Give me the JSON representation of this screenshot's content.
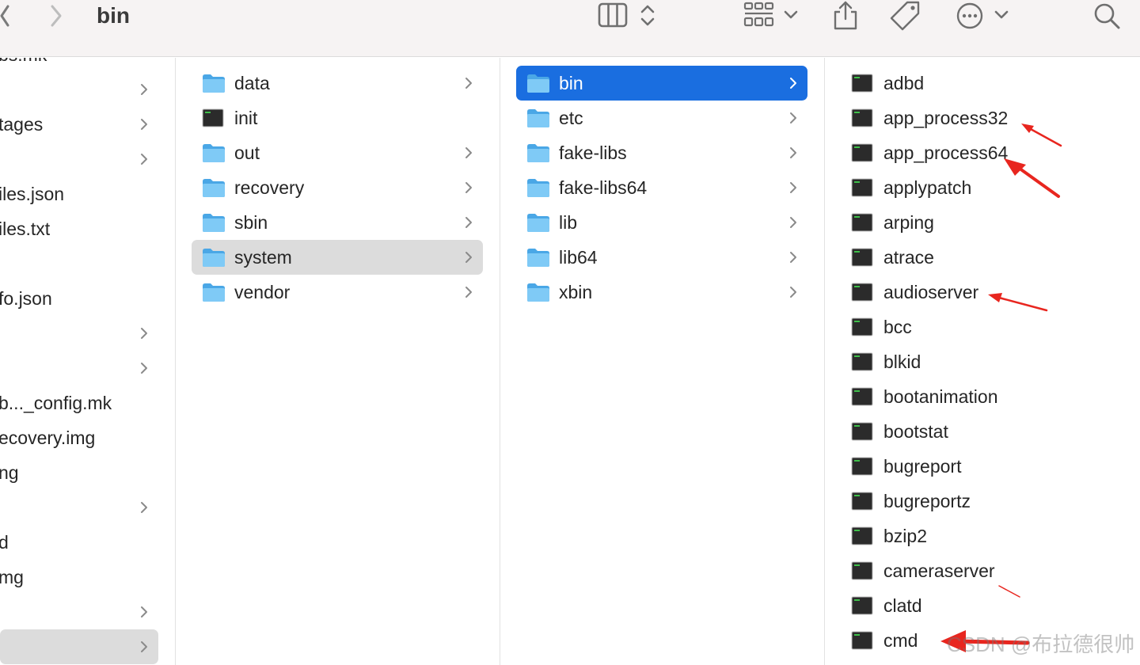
{
  "toolbar": {
    "title": "bin",
    "icons": [
      "back-chevron-icon",
      "forward-chevron-icon",
      "column-view-icon",
      "view-switch-updown-icon",
      "group-grid-icon",
      "chevron-down-icon",
      "share-icon",
      "tag-icon",
      "more-icon",
      "search-icon"
    ]
  },
  "sidebar_partial": {
    "items": [
      {
        "label": "bs.mk",
        "chevron": false
      },
      {
        "label": "",
        "chevron": true
      },
      {
        "label": "tages",
        "chevron": true
      },
      {
        "label": "",
        "chevron": true
      },
      {
        "label": "iles.json",
        "chevron": false
      },
      {
        "label": "iles.txt",
        "chevron": false
      },
      {
        "label": "",
        "chevron": false
      },
      {
        "label": "fo.json",
        "chevron": false
      },
      {
        "label": "",
        "chevron": true
      },
      {
        "label": "",
        "chevron": true
      },
      {
        "label": "b..._config.mk",
        "chevron": false
      },
      {
        "label": "ecovery.img",
        "chevron": false
      },
      {
        "label": "ng",
        "chevron": false
      },
      {
        "label": "",
        "chevron": true
      },
      {
        "label": "d",
        "chevron": false
      },
      {
        "label": "mg",
        "chevron": false
      },
      {
        "label": "",
        "chevron": true
      },
      {
        "label": "",
        "chevron": true
      }
    ]
  },
  "column_root": {
    "items": [
      {
        "name": "data",
        "kind": "folder",
        "chevron": true
      },
      {
        "name": "init",
        "kind": "exec",
        "chevron": false
      },
      {
        "name": "out",
        "kind": "folder",
        "chevron": true
      },
      {
        "name": "recovery",
        "kind": "folder",
        "chevron": true
      },
      {
        "name": "sbin",
        "kind": "folder",
        "chevron": true
      },
      {
        "name": "system",
        "kind": "folder",
        "chevron": true,
        "state": "selected-inactive"
      },
      {
        "name": "vendor",
        "kind": "folder",
        "chevron": true
      }
    ]
  },
  "column_system": {
    "items": [
      {
        "name": "bin",
        "kind": "folder",
        "chevron": true,
        "state": "selected-active"
      },
      {
        "name": "etc",
        "kind": "folder",
        "chevron": true
      },
      {
        "name": "fake-libs",
        "kind": "folder",
        "chevron": true
      },
      {
        "name": "fake-libs64",
        "kind": "folder",
        "chevron": true
      },
      {
        "name": "lib",
        "kind": "folder",
        "chevron": true
      },
      {
        "name": "lib64",
        "kind": "folder",
        "chevron": true
      },
      {
        "name": "xbin",
        "kind": "folder",
        "chevron": true
      }
    ]
  },
  "column_bin": {
    "items": [
      {
        "name": "adbd",
        "kind": "exec"
      },
      {
        "name": "app_process32",
        "kind": "exec"
      },
      {
        "name": "app_process64",
        "kind": "exec"
      },
      {
        "name": "applypatch",
        "kind": "exec"
      },
      {
        "name": "arping",
        "kind": "exec"
      },
      {
        "name": "atrace",
        "kind": "exec"
      },
      {
        "name": "audioserver",
        "kind": "exec"
      },
      {
        "name": "bcc",
        "kind": "exec"
      },
      {
        "name": "blkid",
        "kind": "exec"
      },
      {
        "name": "bootanimation",
        "kind": "exec"
      },
      {
        "name": "bootstat",
        "kind": "exec"
      },
      {
        "name": "bugreport",
        "kind": "exec"
      },
      {
        "name": "bugreportz",
        "kind": "exec"
      },
      {
        "name": "bzip2",
        "kind": "exec"
      },
      {
        "name": "cameraserver",
        "kind": "exec"
      },
      {
        "name": "clatd",
        "kind": "exec"
      },
      {
        "name": "cmd",
        "kind": "exec"
      }
    ]
  },
  "watermark": {
    "text": "CSDN @布拉德很帅"
  },
  "colors": {
    "toolbar_bg": "#f6f3f3",
    "selection_active": "#1a6ee0",
    "selection_inactive": "#dcdcdc",
    "folder": "#5cb8f0",
    "annotation_arrow": "#e8261f"
  }
}
